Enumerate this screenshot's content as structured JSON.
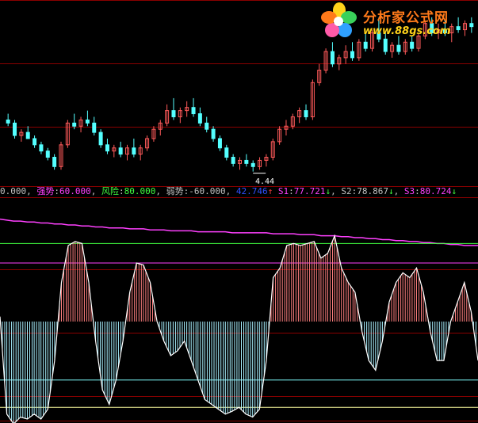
{
  "logo": {
    "title": "分析家公式网",
    "url": "www.88gs.com"
  },
  "price_pane": {
    "low_marker_label": "4.44"
  },
  "legend": {
    "first_value": "0.000",
    "strong_label": "强势",
    "strong_value": "60.000",
    "risk_label": "风险",
    "risk_value": "80.000",
    "weak_label": "弱势",
    "weak_value": "-60.000",
    "main_value": "42.746",
    "main_arrow": "↑",
    "s1_label": "S1",
    "s1_value": "77.721",
    "s1_arrow": "↓",
    "s2_label": "S2",
    "s2_value": "78.867",
    "s2_arrow": "↓",
    "s3_label": "S3",
    "s3_value": "80.724",
    "s3_arrow": "↓"
  },
  "colors": {
    "up_candle": "#ff5a5a",
    "down_candle": "#54ffff",
    "osc_line": "#ffffff",
    "pos_fill": "#ff8080",
    "neg_fill": "#a8f0ff",
    "strong_line": "#ff40ff",
    "risk_line": "#40ff40",
    "weak_line": "#80ffff",
    "s_line": "#ff40ff",
    "axis_line": "#8a0000",
    "legend_label_strong": "#ff40ff",
    "legend_label_risk": "#40ff40",
    "legend_label_weak": "#c0c0c0",
    "legend_main": "#3050ff",
    "legend_s1": "#ff40ff",
    "legend_s2": "#c0c0c0",
    "legend_s3": "#ff40ff",
    "up_arrow": "#ff4040",
    "down_arrow": "#40ff40"
  },
  "chart_data": [
    {
      "type": "candlestick",
      "title": "",
      "ylim": [
        4.2,
        9.6
      ],
      "series": [
        {
          "values": [
            [
              6.1,
              6.3,
              5.9,
              6.0
            ],
            [
              6.0,
              6.1,
              5.5,
              5.6
            ],
            [
              5.6,
              5.8,
              5.4,
              5.7
            ],
            [
              5.7,
              5.9,
              5.5,
              5.5
            ],
            [
              5.5,
              5.6,
              5.2,
              5.3
            ],
            [
              5.3,
              5.4,
              5.0,
              5.1
            ],
            [
              5.1,
              5.2,
              4.8,
              4.9
            ],
            [
              4.9,
              5.0,
              4.5,
              4.6
            ],
            [
              4.6,
              5.4,
              4.5,
              5.3
            ],
            [
              5.3,
              6.1,
              5.2,
              6.0
            ],
            [
              6.0,
              6.3,
              5.8,
              5.9
            ],
            [
              5.9,
              6.2,
              5.7,
              6.1
            ],
            [
              6.1,
              6.4,
              5.9,
              6.0
            ],
            [
              6.0,
              6.2,
              5.6,
              5.7
            ],
            [
              5.7,
              5.8,
              5.2,
              5.3
            ],
            [
              5.3,
              5.5,
              5.0,
              5.1
            ],
            [
              5.1,
              5.3,
              4.9,
              5.2
            ],
            [
              5.2,
              5.4,
              4.9,
              5.0
            ],
            [
              5.0,
              5.3,
              4.8,
              5.2
            ],
            [
              5.2,
              5.5,
              4.9,
              5.0
            ],
            [
              5.0,
              5.3,
              4.8,
              5.2
            ],
            [
              5.2,
              5.6,
              5.1,
              5.5
            ],
            [
              5.5,
              5.9,
              5.4,
              5.8
            ],
            [
              5.8,
              6.1,
              5.6,
              6.0
            ],
            [
              6.0,
              6.6,
              5.9,
              6.4
            ],
            [
              6.4,
              6.8,
              6.1,
              6.2
            ],
            [
              6.2,
              6.5,
              6.0,
              6.4
            ],
            [
              6.4,
              6.7,
              6.2,
              6.5
            ],
            [
              6.5,
              6.8,
              6.2,
              6.3
            ],
            [
              6.3,
              6.5,
              5.9,
              6.0
            ],
            [
              6.0,
              6.2,
              5.7,
              5.8
            ],
            [
              5.8,
              5.9,
              5.4,
              5.5
            ],
            [
              5.5,
              5.6,
              5.1,
              5.2
            ],
            [
              5.2,
              5.3,
              4.8,
              4.9
            ],
            [
              4.9,
              5.0,
              4.6,
              4.7
            ],
            [
              4.7,
              4.9,
              4.5,
              4.8
            ],
            [
              4.8,
              5.0,
              4.6,
              4.7
            ],
            [
              4.7,
              4.8,
              4.44,
              4.6
            ],
            [
              4.6,
              4.9,
              4.5,
              4.8
            ],
            [
              4.8,
              5.0,
              4.6,
              4.9
            ],
            [
              4.9,
              5.5,
              4.8,
              5.4
            ],
            [
              5.4,
              5.9,
              5.3,
              5.8
            ],
            [
              5.8,
              6.1,
              5.6,
              5.9
            ],
            [
              5.9,
              6.3,
              5.8,
              6.2
            ],
            [
              6.2,
              6.5,
              6.0,
              6.4
            ],
            [
              6.4,
              6.6,
              6.1,
              6.2
            ],
            [
              6.2,
              7.4,
              6.1,
              7.3
            ],
            [
              7.3,
              7.9,
              7.2,
              7.7
            ],
            [
              7.7,
              8.4,
              7.6,
              8.3
            ],
            [
              8.3,
              8.6,
              7.8,
              7.9
            ],
            [
              7.9,
              8.2,
              7.7,
              8.1
            ],
            [
              8.1,
              8.5,
              7.9,
              8.3
            ],
            [
              8.3,
              8.6,
              8.0,
              8.1
            ],
            [
              8.1,
              8.7,
              8.0,
              8.6
            ],
            [
              8.6,
              8.9,
              8.3,
              8.4
            ],
            [
              8.4,
              9.0,
              8.3,
              8.9
            ],
            [
              8.9,
              9.4,
              8.6,
              8.7
            ],
            [
              8.7,
              8.9,
              8.2,
              8.3
            ],
            [
              8.3,
              8.6,
              8.1,
              8.5
            ],
            [
              8.5,
              8.8,
              8.2,
              8.3
            ],
            [
              8.3,
              8.7,
              8.2,
              8.6
            ],
            [
              8.6,
              8.8,
              8.3,
              8.4
            ],
            [
              8.4,
              8.9,
              8.3,
              8.8
            ],
            [
              8.8,
              9.3,
              8.7,
              9.2
            ],
            [
              9.2,
              9.4,
              8.8,
              8.9
            ],
            [
              8.9,
              9.2,
              8.7,
              9.0
            ],
            [
              9.0,
              9.3,
              8.8,
              8.9
            ],
            [
              8.9,
              9.2,
              8.6,
              9.1
            ],
            [
              9.1,
              9.4,
              8.9,
              9.0
            ],
            [
              9.0,
              9.3,
              8.8,
              9.2
            ],
            [
              9.2,
              9.4,
              8.9,
              9.1
            ]
          ]
        }
      ]
    },
    {
      "type": "line",
      "title": "",
      "ylim": [
        -100,
        125
      ],
      "reference_lines": {
        "risk": 80,
        "strong": 60,
        "zero": 0,
        "weak": -60
      },
      "series": [
        {
          "name": "S1",
          "values": [
            105,
            104,
            103,
            103,
            102,
            102,
            101,
            101,
            100,
            100,
            99,
            99,
            98,
            98,
            97,
            97,
            96,
            96,
            96,
            95,
            95,
            95,
            94,
            94,
            94,
            93,
            93,
            93,
            93,
            92,
            92,
            92,
            92,
            92,
            91,
            91,
            91,
            91,
            91,
            91,
            90,
            90,
            90,
            90,
            89,
            89,
            89,
            88,
            88,
            88,
            87,
            87,
            86,
            86,
            85,
            85,
            84,
            84,
            83,
            83,
            82,
            82,
            81,
            81,
            80,
            80,
            79,
            79,
            78,
            78,
            78
          ]
        },
        {
          "values": [
            5,
            -95,
            -105,
            -98,
            -100,
            -95,
            -100,
            -90,
            -40,
            40,
            78,
            82,
            80,
            40,
            -20,
            -70,
            -85,
            -60,
            -20,
            30,
            60,
            58,
            40,
            0,
            -20,
            -35,
            -30,
            -20,
            -40,
            -60,
            -80,
            -85,
            -90,
            -95,
            -92,
            -88,
            -95,
            -98,
            -90,
            -40,
            45,
            55,
            78,
            80,
            78,
            80,
            82,
            65,
            70,
            88,
            55,
            40,
            30,
            -10,
            -40,
            -50,
            -20,
            20,
            40,
            50,
            45,
            55,
            30,
            -10,
            -40,
            -40,
            0,
            20,
            40,
            10,
            -40
          ]
        }
      ]
    }
  ]
}
